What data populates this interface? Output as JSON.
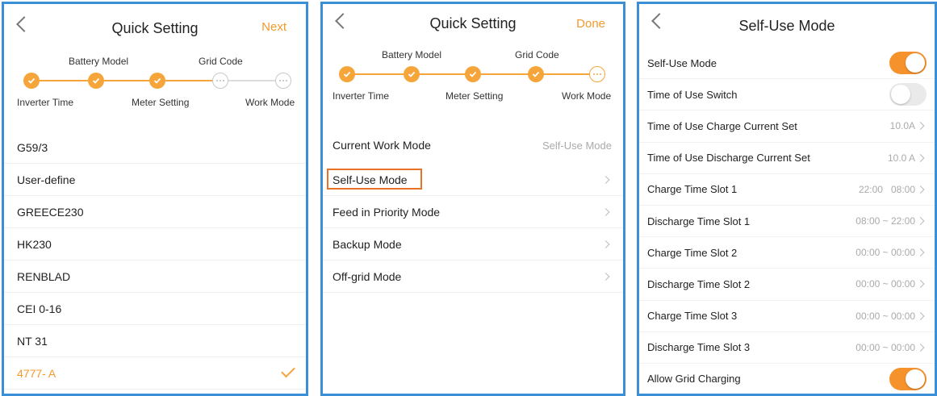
{
  "panel1": {
    "title": "Quick Setting",
    "next_label": "Next",
    "steps": [
      "Inverter Time",
      "Battery Model",
      "Meter Setting",
      "Grid Code",
      "Work Mode"
    ],
    "grid_codes": [
      "G59/3",
      "User-define",
      "GREECE230",
      "HK230",
      "RENBLAD",
      "CEI 0-16",
      "NT 31",
      "4777- A"
    ],
    "selected_code": "4777- A"
  },
  "panel2": {
    "title": "Quick Setting",
    "done_label": "Done",
    "steps": [
      "Inverter Time",
      "Battery Model",
      "Meter Setting",
      "Grid Code",
      "Work Mode"
    ],
    "current_work_mode_label": "Current Work Mode",
    "current_work_mode_value": "Self-Use Mode",
    "modes": [
      "Self-Use Mode",
      "Feed in Priority Mode",
      "Backup Mode",
      "Off-grid Mode"
    ]
  },
  "panel3": {
    "title": "Self-Use Mode",
    "rows": [
      {
        "label": "Self-Use Mode",
        "toggle": true
      },
      {
        "label": "Time of Use Switch",
        "toggle": false
      },
      {
        "label": "Time of Use Charge Current Set",
        "value": "10.0A"
      },
      {
        "label": "Time of Use Discharge Current Set",
        "value": "10.0 A"
      },
      {
        "label": "Charge Time Slot 1",
        "value": "22:00   08:00"
      },
      {
        "label": "Discharge Time Slot 1",
        "value": "08:00 ~ 22:00"
      },
      {
        "label": "Charge Time Slot 2",
        "value": "00:00 ~ 00:00"
      },
      {
        "label": "Discharge Time Slot 2",
        "value": "00:00 ~ 00:00"
      },
      {
        "label": "Charge Time Slot 3",
        "value": "00:00 ~ 00:00"
      },
      {
        "label": "Discharge Time Slot 3",
        "value": "00:00 ~ 00:00"
      },
      {
        "label": "Allow Grid Charging",
        "toggle": true
      }
    ]
  },
  "colors": {
    "accent": "#f5a53a",
    "frame": "#3a8fd6",
    "highlight": "#e8722a"
  }
}
